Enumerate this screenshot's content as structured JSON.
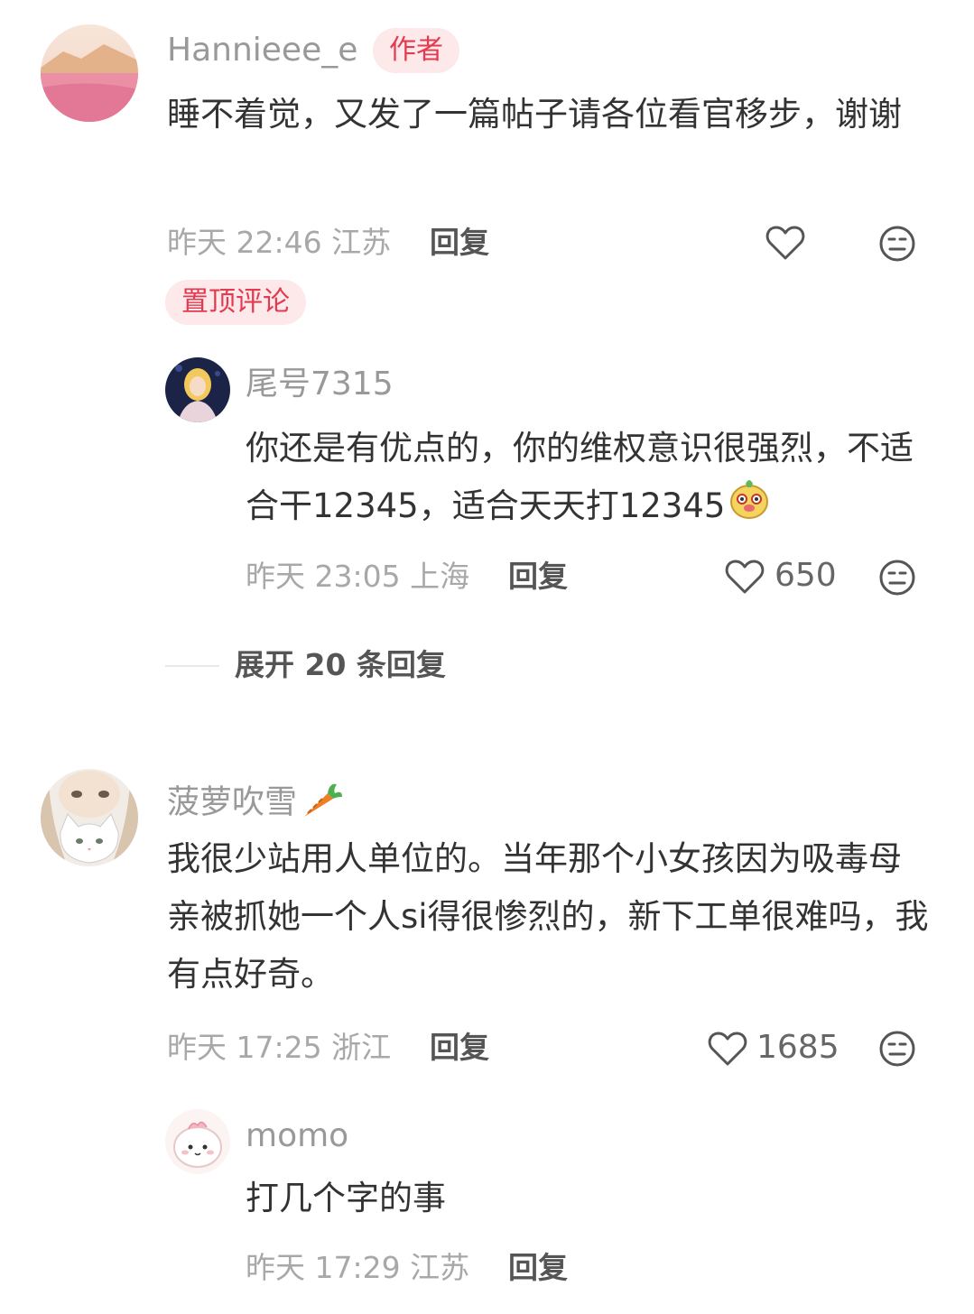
{
  "comments": [
    {
      "username": "Hannieee_e",
      "author_tag": "作者",
      "text": "睡不着觉，又发了一篇帖子请各位看官移步，谢谢",
      "time": "昨天 22:46 江苏",
      "reply_label": "回复",
      "pinned_label": "置顶评论",
      "replies": [
        {
          "username": "尾号7315",
          "text": "你还是有优点的，你的维权意识很强烈，不适合干12345，适合天天打12345",
          "emoji": "dog-face-emoji",
          "time": "昨天 23:05 上海",
          "reply_label": "回复",
          "likes": "650"
        }
      ],
      "expand_label": "展开 20 条回复"
    },
    {
      "username": "菠萝吹雪",
      "username_emoji": "carrot-emoji",
      "text": "我很少站用人单位的。当年那个小女孩因为吸毒母亲被抓她一个人si得很惨烈的，新下工单很难吗，我有点好奇。",
      "time": "昨天 17:25 浙江",
      "reply_label": "回复",
      "likes": "1685",
      "replies": [
        {
          "username": "momo",
          "text": "打几个字的事",
          "time": "昨天 17:29 江苏",
          "reply_label": "回复"
        }
      ]
    }
  ],
  "colors": {
    "accent": "#e43a4f",
    "tag_bg": "#fde8ea",
    "meta": "#a8a8a8"
  }
}
